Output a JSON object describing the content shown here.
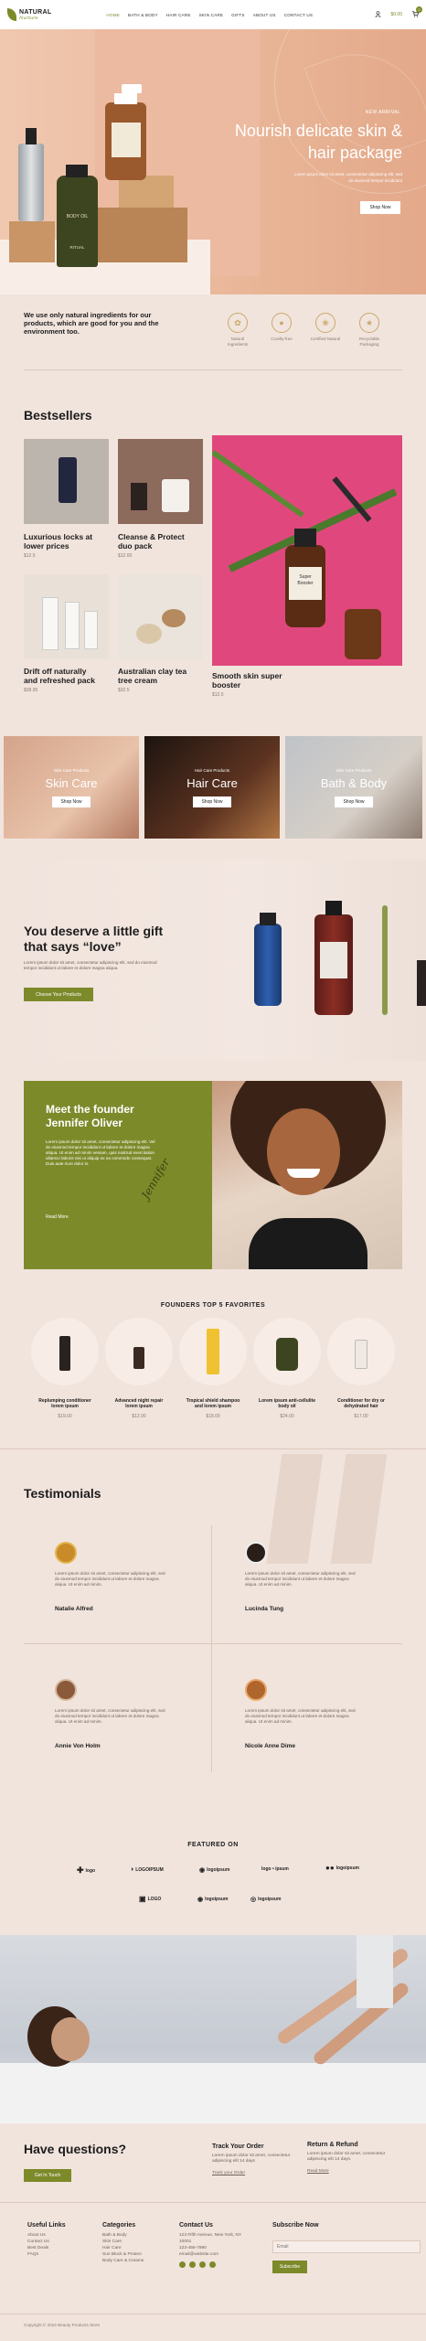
{
  "header": {
    "logo_main": "NATURAL",
    "logo_sub": "Nurture",
    "nav": [
      "HOME",
      "BATH & BODY",
      "HAIR CARE",
      "SKIN CARE",
      "GIFTS",
      "ABOUT US",
      "CONTACT US"
    ],
    "cart_total": "$0.00",
    "cart_count": "0",
    "user_icon": "user-icon",
    "cart_icon": "cart-icon"
  },
  "hero": {
    "kicker": "NEW ARRIVAL",
    "title_line1": "Nourish delicate skin &",
    "title_line2": "hair package",
    "subtitle_line1": "Lorem ipsum dolor sit amet, consectetur adipiscing elit, sed",
    "subtitle_line2": "do eiusmod tempor incididunt",
    "button": "Shop Now",
    "bottle_label1": "BODY OIL",
    "bottle_label2": "RITUAL"
  },
  "intro": {
    "text_line1": "We use only natural ingredients for our",
    "text_line2": "products, which are good for you and the",
    "text_line3": "environment too.",
    "features": [
      {
        "label1": "Natural",
        "label2": "Ingredients",
        "icon": "plant-pot-icon"
      },
      {
        "label1": "Cruelty-free",
        "label2": "",
        "icon": "rabbit-icon"
      },
      {
        "label1": "Certified Natural",
        "label2": "",
        "icon": "leaf-icon"
      },
      {
        "label1": "Recyclable",
        "label2": "Packaging",
        "icon": "bulb-icon"
      }
    ]
  },
  "bestsellers": {
    "title": "Bestsellers",
    "products": [
      {
        "name1": "Luxurious locks at",
        "name2": "lower prices",
        "price": "$12.5"
      },
      {
        "name1": "Cleanse & Protect",
        "name2": "duo pack",
        "price": "$12.00"
      },
      {
        "name1": "Drift off naturally",
        "name2": "and refreshed pack",
        "price": "$38.95"
      },
      {
        "name1": "Australian clay tea",
        "name2": "tree cream",
        "price": "$32.5"
      },
      {
        "name1": "Smooth skin super",
        "name2": "booster",
        "price": "$12.5"
      }
    ],
    "booster_label1": "Super",
    "booster_label2": "Booster"
  },
  "categories": [
    {
      "kicker": "Skin Care Products",
      "title": "Skin Care",
      "button": "Shop Now"
    },
    {
      "kicker": "Hair Care Products",
      "title": "Hair Care",
      "button": "Shop Now"
    },
    {
      "kicker": "Skin Care Products",
      "title": "Bath & Body",
      "button": "Shop Now"
    }
  ],
  "gift": {
    "title_line1": "You deserve a little gift",
    "title_line2": "that says “love”",
    "text_line1": "Lorem ipsum dolor sit amet, consectetur adipiscing elit, sed do eiusmod",
    "text_line2": "tempor incididunt ut labore et dolore magna aliqua.",
    "button": "Choose Your Products"
  },
  "founder": {
    "title_line1": "Meet the founder",
    "title_line2": "Jennifer Oliver",
    "text_lines": [
      "Lorem ipsum dolor sit amet, consectetur adipiscing elit. Vel",
      "do eiusmod tempor incididunt ut labore et dolore magna",
      "aliqua. Ut enim ad minim veniam, quis nostrud exercitation",
      "ullamco laboris nisi ut aliquip ex ea commodo consequat.",
      "Duis aute irure dolor in."
    ],
    "button": "Read More",
    "signature": "Jennifer"
  },
  "favorites": {
    "title": "FOUNDERS TOP 5 FAVORITES",
    "items": [
      {
        "name1": "Replumping conditioner",
        "name2": "lorem ipsum",
        "price": "$19.00"
      },
      {
        "name1": "Advanced night repair",
        "name2": "lorem ipsum",
        "price": "$12.00"
      },
      {
        "name1": "Tropical shield shampoo",
        "name2": "and lorem ipsum",
        "price": "$18.00"
      },
      {
        "name1": "Lorem ipsum anti-cellulite",
        "name2": "body oil",
        "price": "$24.00"
      },
      {
        "name1": "Conditioner for dry or",
        "name2": "dehydrated hair",
        "price": "$17.00"
      }
    ]
  },
  "testimonials": {
    "title": "Testimonials",
    "items": [
      {
        "line1": "Lorem ipsum dolor sit amet, consectetur adipiscing elit, sed",
        "line2": "do eiusmod tempor incididunt ut labore et dolore magna",
        "line3": "aliqua. Ut enim ad minim.",
        "name": "Natalie Alfred"
      },
      {
        "line1": "Lorem ipsum dolor sit amet, consectetur adipiscing elit, sed",
        "line2": "do eiusmod tempor incididunt ut labore et dolore magna",
        "line3": "aliqua. Ut enim ad minim.",
        "name": "Lucinda Tung"
      },
      {
        "line1": "Lorem ipsum dolor sit amet, consectetur adipiscing elit, sed",
        "line2": "do eiusmod tempor incididunt ut labore et dolore magna",
        "line3": "aliqua. Ut enim ad minim.",
        "name": "Annie Von Holm"
      },
      {
        "line1": "Lorem ipsum dolor sit amet, consectetur adipiscing elit, sed",
        "line2": "do eiusmod tempor incididunt ut labore et dolore magna",
        "line3": "aliqua. Ut enim ad minim.",
        "name": "Nicole Anne Dime"
      }
    ]
  },
  "featured": {
    "title": "FEATURED ON",
    "logos": [
      "logo",
      "LOGOIPSUM",
      "logoipsum",
      "logo • ipsum",
      "logoipsum",
      "LOGO",
      "logoipsum",
      "logoipsum"
    ]
  },
  "questions": {
    "title": "Have questions?",
    "button": "Get In Touch",
    "track_title": "Track Your Order",
    "track_text1": "Lorem ipsum dolor sit amet, consectetur",
    "track_text2": "adipiscing elit 14 days",
    "track_link": "Track your Order",
    "return_title": "Return & Refund",
    "return_text1": "Lorem ipsum dolor sit amet, consectetur",
    "return_text2": "adipiscing elit 14 days.",
    "return_link": "Read More"
  },
  "footer": {
    "useful_title": "Useful Links",
    "useful": [
      "About Us",
      "Contact Us",
      "Best Deals",
      "FAQs"
    ],
    "cat_title": "Categories",
    "cats": [
      "Bath & Body",
      "Skin Care",
      "Hair Care",
      "Sun Block & Protect",
      "Body Care & Creams"
    ],
    "contact_title": "Contact Us",
    "contact": [
      "123 Fifth Avenue, New York, NY",
      "10001",
      "123-456-7890",
      "email@website.com"
    ],
    "subscribe_title": "Subscribe Now",
    "email_placeholder": "Email",
    "subscribe_button": "Subscribe",
    "copyright": "Copyright © 2024 Beauty Products Store"
  }
}
